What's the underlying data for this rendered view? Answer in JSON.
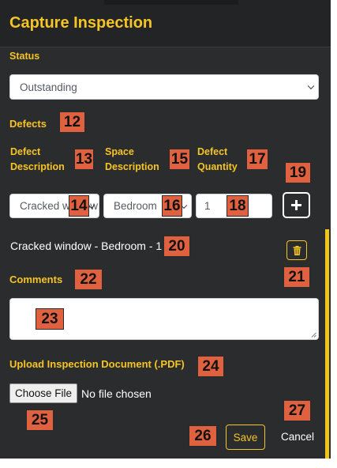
{
  "modal": {
    "title": "Capture Inspection"
  },
  "status": {
    "label": "Status",
    "value": "Outstanding"
  },
  "defects": {
    "heading": "Defects",
    "columns": {
      "description_line1": "Defect",
      "description_line2": "Description",
      "space_line1": "Space",
      "space_line2": "Description",
      "quantity_line1": "Defect",
      "quantity_line2": "Quantity"
    },
    "description_value": "Cracked window",
    "space_value": "Bedroom",
    "quantity_value": "1",
    "add_icon": "plus-icon",
    "list": [
      {
        "text": "Cracked window - Bedroom - 1",
        "delete_icon": "trash-icon"
      }
    ]
  },
  "comments": {
    "label": "Comments",
    "value": ""
  },
  "upload": {
    "label": "Upload Inspection Document (.PDF)",
    "button_label": "Choose File",
    "status_text": "No file chosen"
  },
  "actions": {
    "save_label": "Save",
    "cancel_label": "Cancel"
  },
  "annotations": [
    "12",
    "13",
    "14",
    "15",
    "16",
    "17",
    "18",
    "19",
    "20",
    "21",
    "22",
    "23",
    "24",
    "25",
    "26",
    "27"
  ],
  "colors": {
    "accent": "#f5c425",
    "background": "#2b2c2e",
    "header": "#232426",
    "badge": "#e0613f"
  }
}
